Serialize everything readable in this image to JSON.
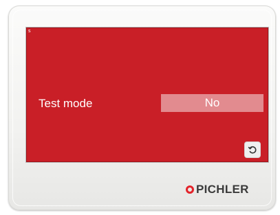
{
  "screen": {
    "corner_label": "s",
    "setting_label": "Test mode",
    "setting_value": "No",
    "background_color": "#c91f27",
    "value_box_color": "#e28b8f",
    "back_icon": "undo-icon"
  },
  "brand": {
    "name": "PICHLER",
    "mark_color": "#e3242b"
  }
}
